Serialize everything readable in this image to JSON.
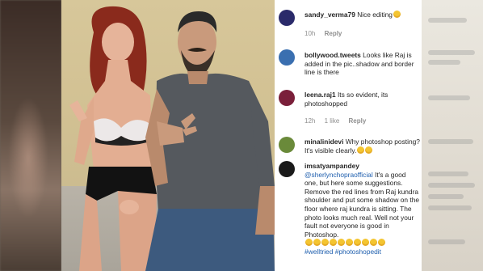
{
  "photo": {
    "description_icon": "photo-icon"
  },
  "comments": [
    {
      "username": "sandy_verma79",
      "text": "Nice editing",
      "emojis": 1,
      "time": "10h",
      "likes": "",
      "reply": "Reply",
      "avatar_color": "#2a2a6a"
    },
    {
      "username": "bollywood.tweets",
      "text": "Looks like Raj is added in the pic..shadow and border line is there",
      "emojis": 0,
      "time": "",
      "likes": "",
      "reply": "",
      "avatar_color": "#3a6fb0"
    },
    {
      "username": "leena.raj1",
      "text": "Its so evident, its photoshopped",
      "emojis": 0,
      "time": "12h",
      "likes": "1 like",
      "reply": "Reply",
      "avatar_color": "#7a1f3a"
    },
    {
      "username": "minalinidevi",
      "text": "Why photoshop posting? It's visible clearly.",
      "emojis": 2,
      "time": "",
      "likes": "",
      "reply": "",
      "avatar_color": "#6a8a3a"
    },
    {
      "username": "imsatyampandey",
      "mention": "@sherlynchopraofficial",
      "text": "It's a good one, but here some suggestions. Remove the red lines from Raj kundra shoulder and put some shadow on the floor where raj kundra is sitting. The photo looks much real. Well not your fault not everyone is good in Photoshop.",
      "emojis": 10,
      "hashtags": "#welltried #photoshopedit",
      "time": "",
      "likes": "",
      "reply": "",
      "avatar_color": "#1a1a1a"
    }
  ]
}
